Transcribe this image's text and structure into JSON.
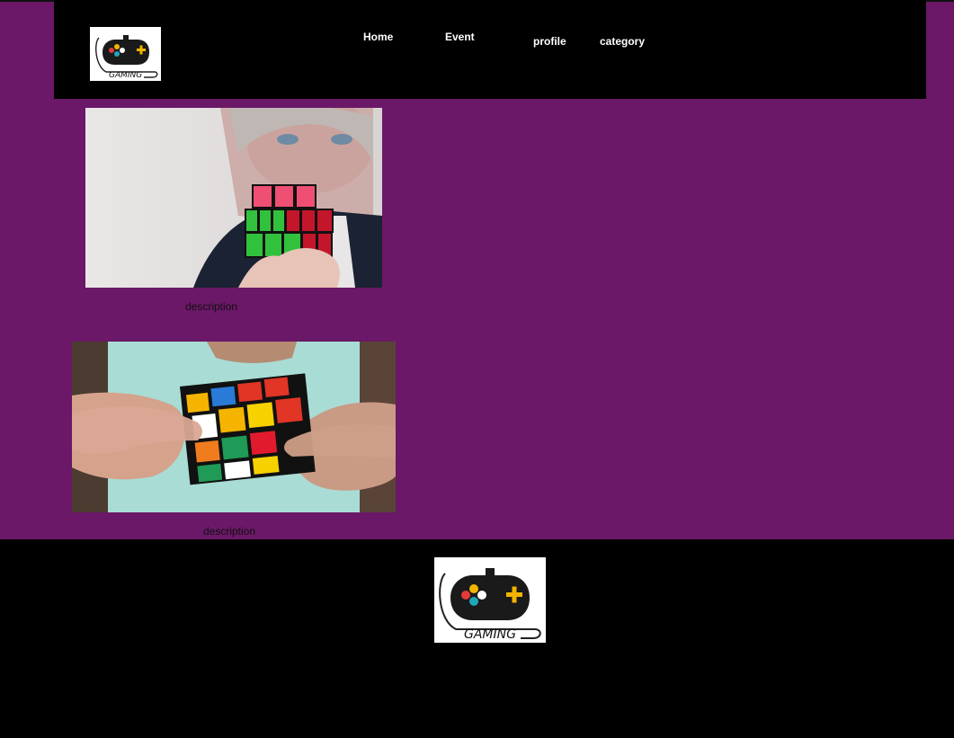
{
  "header": {
    "logo_text": "GAMING",
    "nav": [
      {
        "label": "Home"
      },
      {
        "label": "Event"
      },
      {
        "label": "profile"
      },
      {
        "label": "category"
      }
    ]
  },
  "cards": [
    {
      "description": "description",
      "image": "rubiks-cube-man-photo"
    },
    {
      "description": "description",
      "image": "rubiks-cube-hands-photo"
    }
  ],
  "footer": {
    "logo_text": "GAMING"
  },
  "colors": {
    "background": "#6a1867",
    "header": "#000000",
    "footer": "#000000",
    "nav_text": "#ffffff"
  }
}
